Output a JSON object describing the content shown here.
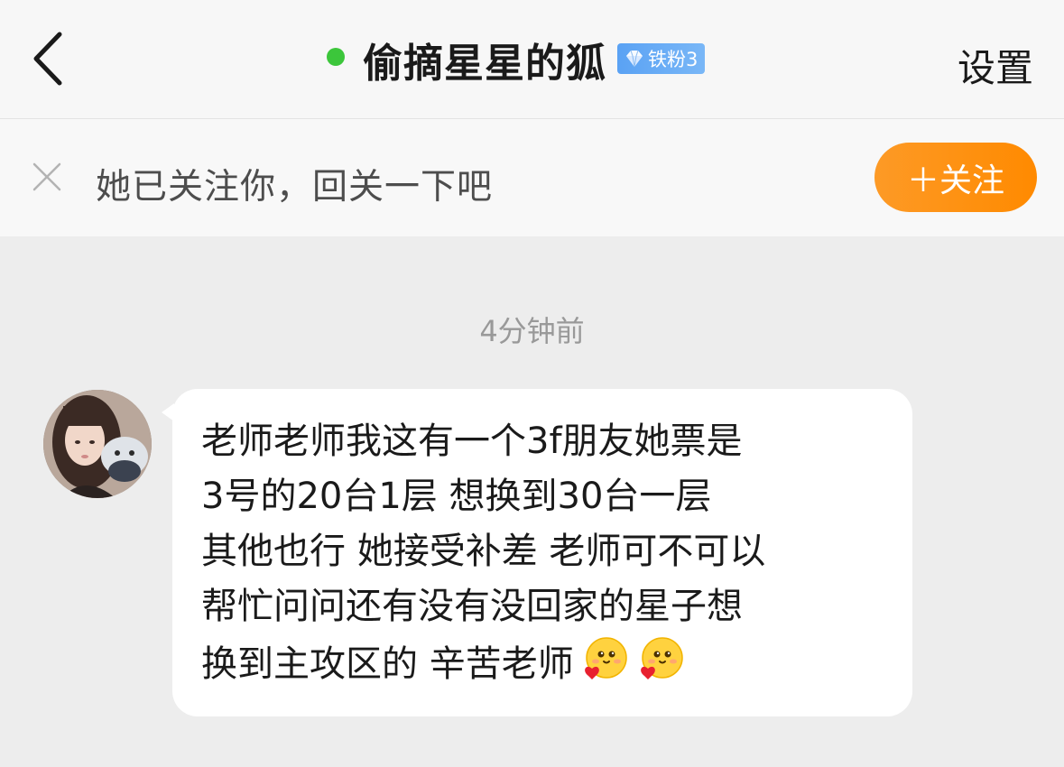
{
  "header": {
    "back_icon": "chevron-left-icon",
    "title": "偷摘星星的狐",
    "online_status_color": "#3cc63b",
    "badge": {
      "icon": "diamond-icon",
      "label": "铁粉3"
    },
    "settings_label": "设置"
  },
  "follow_prompt": {
    "close_icon": "close-icon",
    "text": "她已关注你，回关一下吧",
    "button_label": "＋关注",
    "button_color": "#ff8f0f"
  },
  "chat": {
    "timestamp": "4分钟前",
    "messages": [
      {
        "sender": "other",
        "lines": [
          "老师老师我这有一个3f朋友她票是",
          "3号的20台1层 想换到30台一层",
          "其他也行 她接受补差 老师可不可以",
          "帮忙问问还有没有没回家的星子想",
          "换到主攻区的 辛苦老师"
        ],
        "emojis": [
          "heart-hug-emoji",
          "heart-hug-emoji"
        ]
      }
    ]
  }
}
